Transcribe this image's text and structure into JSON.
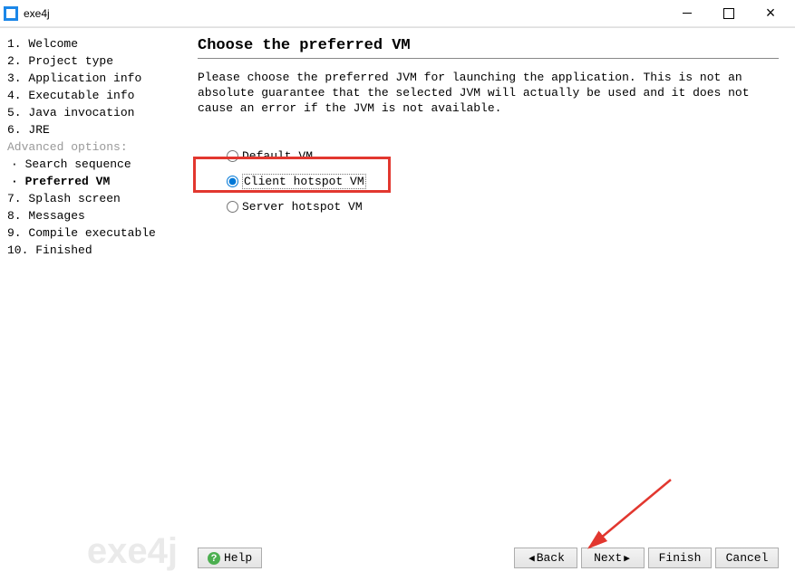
{
  "window": {
    "title": "exe4j"
  },
  "sidebar": {
    "steps": [
      {
        "num": "1.",
        "label": "Welcome"
      },
      {
        "num": "2.",
        "label": "Project type"
      },
      {
        "num": "3.",
        "label": "Application info"
      },
      {
        "num": "4.",
        "label": "Executable info"
      },
      {
        "num": "5.",
        "label": "Java invocation"
      },
      {
        "num": "6.",
        "label": "JRE"
      }
    ],
    "advanced_header": "Advanced options:",
    "sub_items": [
      {
        "bullet": "·",
        "label": "Search sequence",
        "current": false
      },
      {
        "bullet": "·",
        "label": "Preferred VM",
        "current": true
      }
    ],
    "steps_after": [
      {
        "num": "7.",
        "label": "Splash screen"
      },
      {
        "num": "8.",
        "label": "Messages"
      },
      {
        "num": "9.",
        "label": "Compile executable"
      },
      {
        "num": "10.",
        "label": "Finished"
      }
    ],
    "watermark": "exe4j"
  },
  "content": {
    "title": "Choose the preferred VM",
    "description": "Please choose the preferred JVM for launching the application. This is not an absolute guarantee that the selected JVM will actually be used and it does not cause an error if the JVM is not available.",
    "options": [
      {
        "id": "default",
        "label": "Default VM",
        "selected": false
      },
      {
        "id": "client",
        "label": "Client hotspot VM",
        "selected": true
      },
      {
        "id": "server",
        "label": "Server hotspot VM",
        "selected": false
      }
    ]
  },
  "buttons": {
    "help": "Help",
    "back": "Back",
    "next": "Next",
    "finish": "Finish",
    "cancel": "Cancel"
  }
}
